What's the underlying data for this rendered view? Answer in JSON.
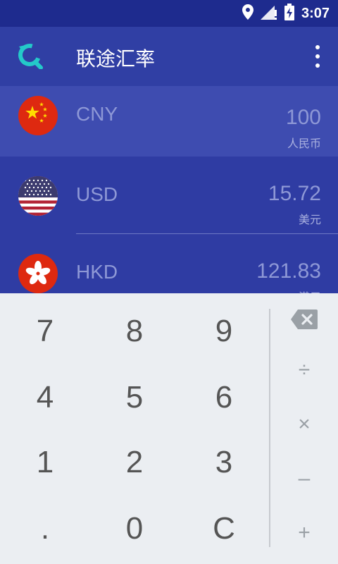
{
  "status_bar": {
    "time": "3:07"
  },
  "app_bar": {
    "title": "联途汇率"
  },
  "currencies": [
    {
      "code": "CNY",
      "value": "100",
      "name": "人民币",
      "selected": true
    },
    {
      "code": "USD",
      "value": "15.72",
      "name": "美元",
      "selected": false
    },
    {
      "code": "HKD",
      "value": "121.83",
      "name": "港元",
      "selected": false
    }
  ],
  "keypad": {
    "digits": [
      "7",
      "8",
      "9",
      "4",
      "5",
      "6",
      "1",
      "2",
      "3",
      ".",
      "0",
      "C"
    ],
    "operators": [
      "÷",
      "×",
      "–",
      "+"
    ]
  },
  "colors": {
    "status_bar": "#1E2B8E",
    "app_bar": "#303FA4",
    "list_bg": "#2F3CA3",
    "selected_row": "#3E4CB0",
    "keypad_bg": "#EBEEF2"
  }
}
